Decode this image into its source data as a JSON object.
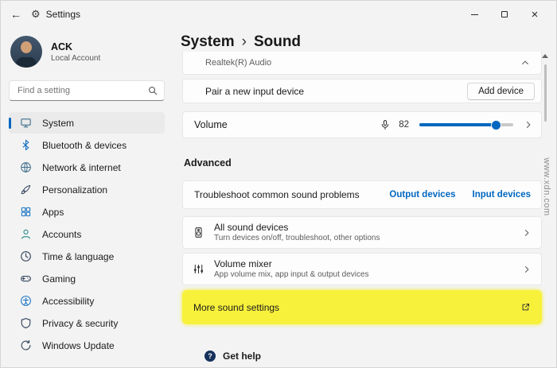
{
  "titlebar": {
    "back_glyph": "←",
    "gear_glyph": "⚙",
    "title": "Settings",
    "close_glyph": "×"
  },
  "sidebar": {
    "user": {
      "name": "ACK",
      "role": "Local Account"
    },
    "search_placeholder": "Find a setting",
    "items": [
      {
        "label": "System",
        "selected": true
      },
      {
        "label": "Bluetooth & devices"
      },
      {
        "label": "Network & internet"
      },
      {
        "label": "Personalization"
      },
      {
        "label": "Apps"
      },
      {
        "label": "Accounts"
      },
      {
        "label": "Time & language"
      },
      {
        "label": "Gaming"
      },
      {
        "label": "Accessibility"
      },
      {
        "label": "Privacy & security"
      },
      {
        "label": "Windows Update"
      }
    ]
  },
  "header": {
    "parent": "System",
    "separator": "›",
    "current": "Sound"
  },
  "content": {
    "device_partial": {
      "label": "Realtek(R) Audio"
    },
    "pair_input": {
      "label": "Pair a new input device",
      "button_label": "Add device"
    },
    "volume": {
      "label": "Volume",
      "value": "82",
      "percent": 82
    },
    "advanced_heading": "Advanced",
    "troubleshoot": {
      "label": "Troubleshoot common sound problems",
      "output_link": "Output devices",
      "input_link": "Input devices"
    },
    "all_sound_devices": {
      "title": "All sound devices",
      "subtitle": "Turn devices on/off, troubleshoot, other options"
    },
    "volume_mixer": {
      "title": "Volume mixer",
      "subtitle": "App volume mix, app input & output devices"
    },
    "more_sound_settings": {
      "label": "More sound settings"
    },
    "get_help": {
      "label": "Get help",
      "icon_glyph": "?"
    }
  },
  "watermark": "www.xdn.com",
  "colors": {
    "accent": "#0067c0",
    "highlight": "#f7f13c",
    "link": "#0067c0",
    "window_bg": "#f3f3f3"
  }
}
